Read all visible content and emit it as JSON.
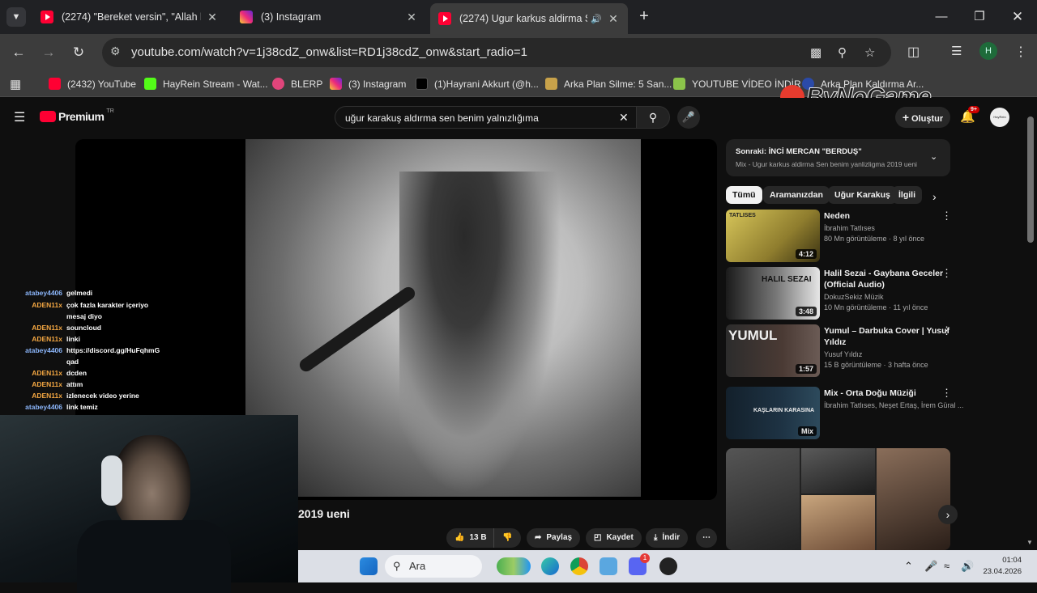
{
  "tabs": [
    {
      "title": "(2274) \"Bereket versin\", \"Allah kaza",
      "favicon": "youtube-icon"
    },
    {
      "title": "(3) Instagram",
      "favicon": "instagram-icon"
    },
    {
      "title": "(2274) Ugur karkus aldirma Se",
      "favicon": "youtube-icon",
      "audio": "speaker-icon"
    }
  ],
  "address_bar": {
    "url": "youtube.com/watch?v=1j38cdZ_onw&list=RD1j38cdZ_onw&start_radio=1"
  },
  "profile_initial": "H",
  "bookmarks": [
    {
      "label": "(2432) YouTube"
    },
    {
      "label": "HayRein Stream - Wat..."
    },
    {
      "label": "BLERP"
    },
    {
      "label": "(3) Instagram"
    },
    {
      "label": "(1)Hayrani Akkurt (@h..."
    },
    {
      "label": "Arka Plan Silme: 5 San..."
    },
    {
      "label": "YOUTUBE VİDEO İNDİR"
    },
    {
      "label": "Arka Plan Kaldırma Ar..."
    }
  ],
  "watermark": "ByNoGame",
  "youtube": {
    "logo_text": "Premium",
    "logo_region": "TR",
    "search_query": "uğur karakuş aldırma sen benim yalnızlığıma",
    "create_label": "Oluştur",
    "notifications_count": "9+",
    "avatar_text": "HayRein"
  },
  "up_next": {
    "title": "Sonraki: İNCİ MERCAN \"BERDUŞ\"",
    "subtitle": "Mix - Ugur karkus aldirma Sen benim yanlizligma 2019 ueni"
  },
  "chips": [
    {
      "label": "Tümü",
      "selected": true
    },
    {
      "label": "Aramanızdan"
    },
    {
      "label": "Uğur Karakuş"
    },
    {
      "label": "İlgili"
    }
  ],
  "recommendations": [
    {
      "title": "Neden",
      "channel": "İbrahim Tatlıses",
      "meta": "80 Mn görüntüleme · 8 yıl önce",
      "duration": "4:12",
      "thumb_text": "TATLISES"
    },
    {
      "title": "Halil Sezai - Gaybana Geceler (Official Audio)",
      "channel": "DokuzSekiz Müzik",
      "meta": "10 Mn görüntüleme · 11 yıl önce",
      "duration": "3:48",
      "thumb_text": "HALIL SEZAI"
    },
    {
      "title": "Yumul – Darbuka Cover | Yusuf Yıldız",
      "channel": "Yusuf Yıldız",
      "meta": "15 B görüntüleme · 3 hafta önce",
      "duration": "1:57",
      "thumb_text": "YUMUL"
    },
    {
      "title": "Mix - Orta Doğu Müziği",
      "channel": "İbrahim Tatlıses, Neşet Ertaş, İrem Güral ...",
      "meta": "",
      "duration": "Mix",
      "thumb_text": "KAŞLARIN KARASINA"
    }
  ],
  "video_title_fragment": "2019 ueni",
  "actions": {
    "likes": "13 B",
    "share": "Paylaş",
    "save": "Kaydet",
    "download": "İndir"
  },
  "chat": [
    {
      "user": "atabey4406",
      "msg": "gelmedi",
      "color": "#8ab4f8"
    },
    {
      "user": "ADEN11x",
      "msg": "çok fazla karakter içeriyo mesaj diyo",
      "color": "#f4a742"
    },
    {
      "user": "ADEN11x",
      "msg": "souncloud",
      "color": "#f4a742"
    },
    {
      "user": "ADEN11x",
      "msg": "linki",
      "color": "#f4a742"
    },
    {
      "user": "atabey4406",
      "msg": "https://discord.gg/HuFqhmGqad",
      "color": "#8ab4f8"
    },
    {
      "user": "ADEN11x",
      "msg": "dcden",
      "color": "#f4a742"
    },
    {
      "user": "ADEN11x",
      "msg": "attım",
      "color": "#f4a742"
    },
    {
      "user": "ADEN11x",
      "msg": "izlenecek video yerine",
      "color": "#f4a742"
    },
    {
      "user": "atabey4406",
      "msg": "link temiz",
      "color": "#8ab4f8"
    }
  ],
  "taskbar": {
    "search_placeholder": "Ara",
    "time": "01:04",
    "date": "23.04.2026",
    "discord_badge": "1"
  }
}
